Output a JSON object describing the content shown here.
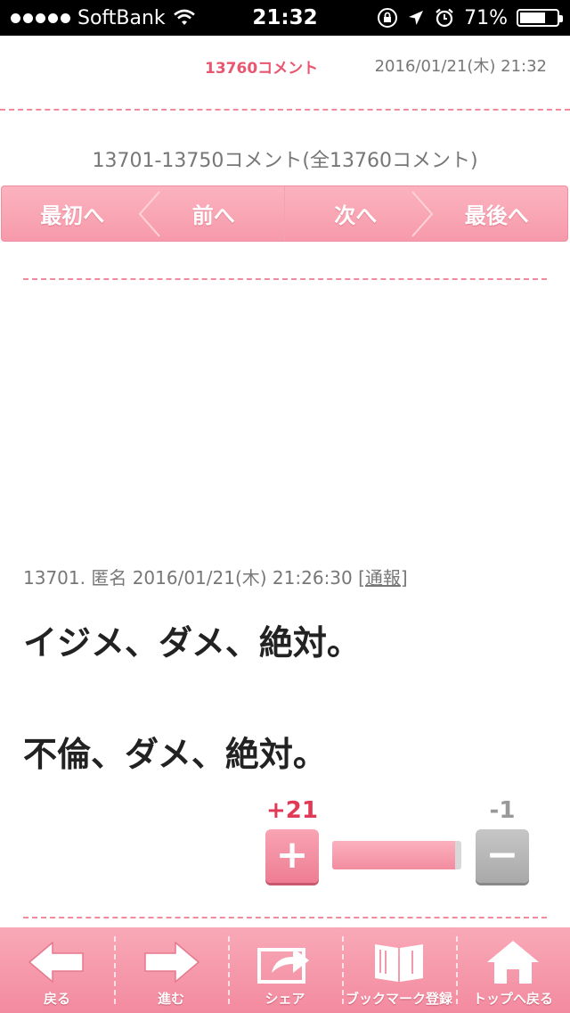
{
  "status_bar": {
    "carrier": "SoftBank",
    "time": "21:32",
    "battery": "71%",
    "battery_level": 0.71
  },
  "header": {
    "comment_count": "13760コメント",
    "datetime": "2016/01/21(木) 21:32"
  },
  "range_title": "13701-13750コメント(全13760コメント)",
  "pager": {
    "first": "最初へ",
    "prev": "前へ",
    "next": "次へ",
    "last": "最後へ"
  },
  "comment": {
    "meta": "13701. 匿名 2016/01/21(木) 21:26:30 [",
    "report": "通報",
    "meta_end": "]",
    "lines": [
      "イジメ、ダメ、絶対。",
      "不倫、ダメ、絶対。"
    ],
    "plus_count": "+21",
    "minus_count": "-1",
    "plus_symbol": "+",
    "minus_symbol": "−",
    "plus_ratio": 0.95
  },
  "toolbar": {
    "back": "戻る",
    "forward": "進む",
    "share": "シェア",
    "bookmark": "ブックマーク登録",
    "top": "トップへ戻る"
  },
  "colors": {
    "accent": "#e8576f",
    "pink": "#f79aab"
  }
}
